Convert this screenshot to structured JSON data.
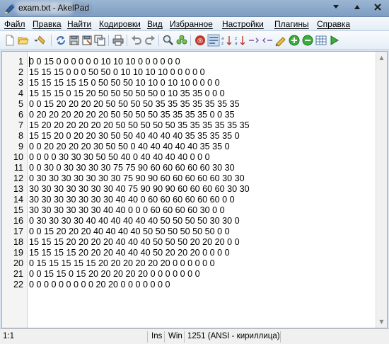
{
  "window": {
    "title": "exam.txt - AkelPad"
  },
  "menu": {
    "items": [
      "Файл",
      "Правка",
      "Найти",
      "Кодировки",
      "Вид",
      "Избранное",
      "Настройки",
      "Плагины",
      "Справка"
    ]
  },
  "toolbar": {
    "buttons": [
      "new-file-icon",
      "open-file-icon",
      "save-file-icon",
      "reopen-icon",
      "save-icon",
      "save-as-icon",
      "save-all-icon",
      "print-icon",
      "undo-icon",
      "redo-icon",
      "find-icon",
      "replace-icon",
      "register-icon",
      "wordwrap-icon",
      "sort-asc-icon",
      "sort-desc-icon",
      "increase-icon",
      "decrease-icon",
      "highlight-icon",
      "zoom-in-icon",
      "zoom-out-icon",
      "table-icon",
      "run-icon"
    ]
  },
  "editor": {
    "lines": [
      {
        "num": "1",
        "text": "0 0 15 0 0 0 0 0 0 10 10 10 0 0 0 0 0 0"
      },
      {
        "num": "2",
        "text": "15 15 15 0 0 0 50 50 0 10 10 10 10 0 0 0 0 0"
      },
      {
        "num": "3",
        "text": "15 15 15 15 15 0 50 50 50 10 10 0 10 10 0 0 0 0"
      },
      {
        "num": "4",
        "text": "15 15 15 0 15 20 50 50 50 50 50 0 10 35 35 0 0 0"
      },
      {
        "num": "5",
        "text": "0 0 15 20 20 20 20 50 50 50 50 35 35 35 35 35 35 35"
      },
      {
        "num": "6",
        "text": "0 20 20 20 20 20 20 50 50 50 50 35 35 35 35 0 0 35"
      },
      {
        "num": "7",
        "text": "15 20 20 20 20 20 20 50 50 50 50 50 35 35 35 35 35 35"
      },
      {
        "num": "8",
        "text": "15 15 20 0 20 20 30 50 50 40 40 40 40 35 35 35 35 0"
      },
      {
        "num": "9",
        "text": "0 0 20 20 20 20 30 50 50 0 40 40 40 40 40 35 35 0"
      },
      {
        "num": "10",
        "text": "0 0 0 0 30 30 30 50 50 40 0 40 40 40 40 0 0 0"
      },
      {
        "num": "11",
        "text": "0 0 30 0 30 30 30 30 75 75 90 60 60 60 60 60 30 30"
      },
      {
        "num": "12",
        "text": "0 30 30 30 30 30 30 30 75 90 90 60 60 60 60 60 30 30"
      },
      {
        "num": "13",
        "text": "30 30 30 30 30 30 30 40 75 90 90 90 60 60 60 60 30 30"
      },
      {
        "num": "14",
        "text": "30 30 30 30 30 30 30 40 40 0 60 60 60 60 60 60 0 0"
      },
      {
        "num": "15",
        "text": "30 30 30 30 30 30 40 40 0 0 0 60 60 60 60 30 0 0"
      },
      {
        "num": "16",
        "text": "0 30 30 30 30 40 40 40 40 40 40 50 50 50 50 30 30 0"
      },
      {
        "num": "17",
        "text": "0 0 15 20 20 20 40 40 40 40 50 50 50 50 50 50 0 0"
      },
      {
        "num": "18",
        "text": "15 15 15 20 20 20 20 40 40 40 50 50 50 20 20 20 0 0"
      },
      {
        "num": "19",
        "text": "15 15 15 15 20 20 20 40 40 40 50 20 20 20 0 0 0 0"
      },
      {
        "num": "20",
        "text": "0 15 15 15 15 15 20 20 20 20 20 20 0 0 0 0 0 0"
      },
      {
        "num": "21",
        "text": "0 0 15 15 0 15 20 20 20 20 20 0 0 0 0 0 0 0"
      },
      {
        "num": "22",
        "text": "0 0 0 0 0 0 0 0 0 20 20 0 0 0 0 0 0 0"
      }
    ]
  },
  "status": {
    "position": "1:1",
    "insert_mode": "Ins",
    "newline": "Win",
    "codepage": "1251  (ANSI - кириллица)"
  }
}
